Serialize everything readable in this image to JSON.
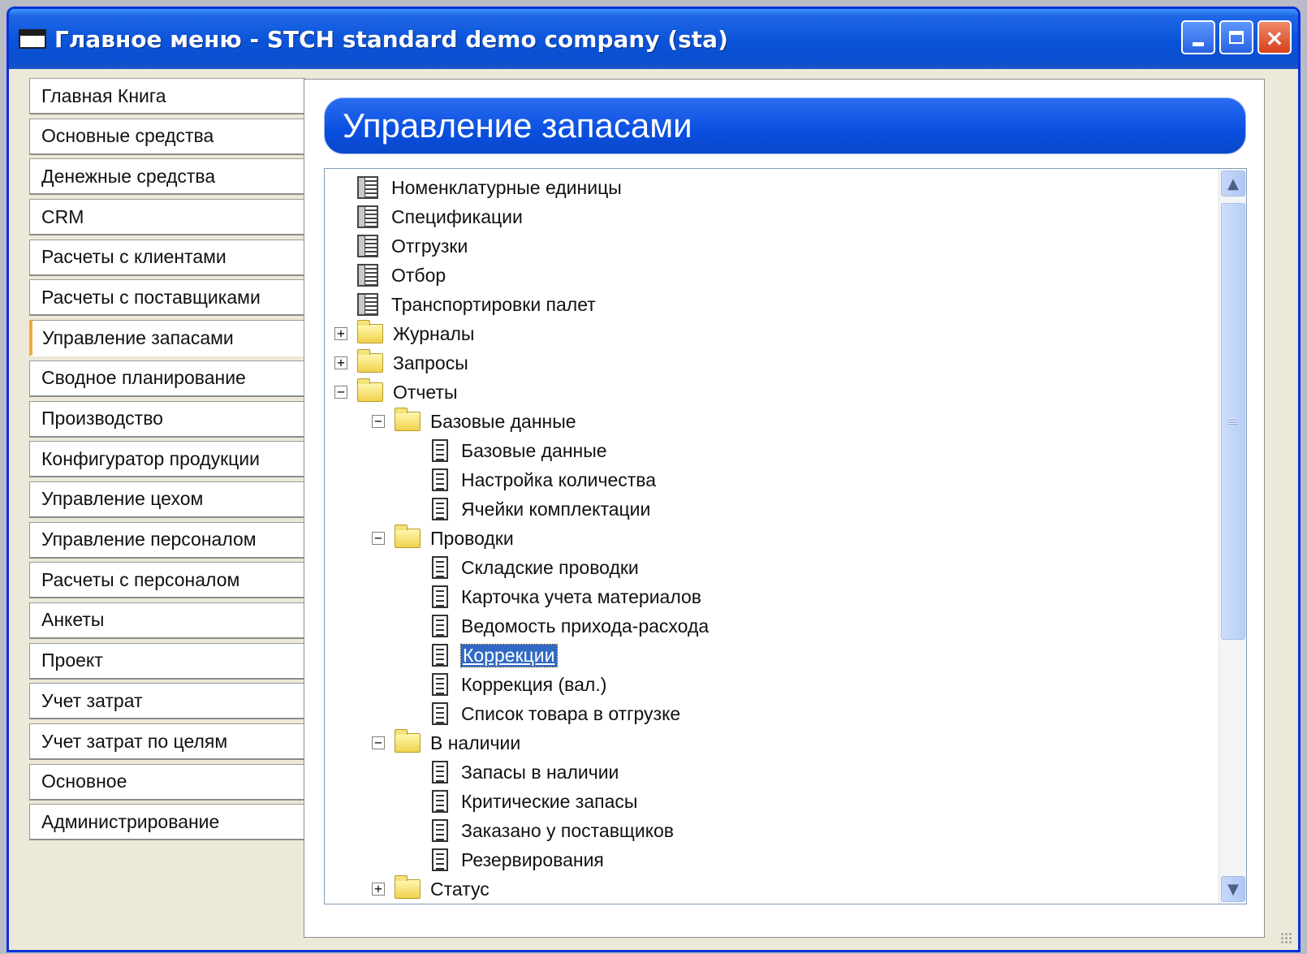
{
  "window": {
    "title": "Главное меню  -  STCH standard demo company (sta)",
    "buttons": {
      "minimize": "minimize",
      "maximize": "maximize",
      "close": "×"
    }
  },
  "nav": {
    "items": [
      {
        "label": "Главная Книга"
      },
      {
        "label": "Основные средства"
      },
      {
        "label": "Денежные средства"
      },
      {
        "label": "CRM"
      },
      {
        "label": "Расчеты с клиентами"
      },
      {
        "label": "Расчеты с поставщиками"
      },
      {
        "label": "Управление запасами",
        "active": true
      },
      {
        "label": "Сводное планирование"
      },
      {
        "label": "Производство"
      },
      {
        "label": "Конфигуратор продукции"
      },
      {
        "label": "Управление цехом"
      },
      {
        "label": "Управление персоналом"
      },
      {
        "label": "Расчеты с персоналом"
      },
      {
        "label": "Анкеты"
      },
      {
        "label": "Проект"
      },
      {
        "label": "Учет затрат"
      },
      {
        "label": "Учет затрат по целям"
      },
      {
        "label": "Основное"
      },
      {
        "label": "Администрирование"
      }
    ]
  },
  "section": {
    "title": "Управление запасами"
  },
  "tree": {
    "nodes": [
      {
        "label": "Номенклатурные единицы",
        "depth": 0,
        "type": "list",
        "expander": null
      },
      {
        "label": "Спецификации",
        "depth": 0,
        "type": "list",
        "expander": null
      },
      {
        "label": "Отгрузки",
        "depth": 0,
        "type": "list",
        "expander": null
      },
      {
        "label": "Отбор",
        "depth": 0,
        "type": "list",
        "expander": null
      },
      {
        "label": "Транспортировки палет",
        "depth": 0,
        "type": "list",
        "expander": null
      },
      {
        "label": "Журналы",
        "depth": 0,
        "type": "folder",
        "expander": "+"
      },
      {
        "label": "Запросы",
        "depth": 0,
        "type": "folder",
        "expander": "+"
      },
      {
        "label": "Отчеты",
        "depth": 0,
        "type": "folder",
        "expander": "−"
      },
      {
        "label": "Базовые данные",
        "depth": 1,
        "type": "folder",
        "expander": "−"
      },
      {
        "label": "Базовые данные",
        "depth": 2,
        "type": "report",
        "expander": null
      },
      {
        "label": "Настройка количества",
        "depth": 2,
        "type": "report",
        "expander": null
      },
      {
        "label": "Ячейки комплектации",
        "depth": 2,
        "type": "report",
        "expander": null
      },
      {
        "label": "Проводки",
        "depth": 1,
        "type": "folder",
        "expander": "−"
      },
      {
        "label": "Складские проводки",
        "depth": 2,
        "type": "report",
        "expander": null
      },
      {
        "label": "Карточка учета материалов",
        "depth": 2,
        "type": "report",
        "expander": null
      },
      {
        "label": "Ведомость прихода-расхода",
        "depth": 2,
        "type": "report",
        "expander": null
      },
      {
        "label": "Коррекции",
        "depth": 2,
        "type": "report",
        "expander": null,
        "selected": true
      },
      {
        "label": "Коррекция (вал.)",
        "depth": 2,
        "type": "report",
        "expander": null
      },
      {
        "label": "Список товара в отгрузке",
        "depth": 2,
        "type": "report",
        "expander": null
      },
      {
        "label": "В наличии",
        "depth": 1,
        "type": "folder",
        "expander": "−"
      },
      {
        "label": "Запасы в наличии",
        "depth": 2,
        "type": "report",
        "expander": null
      },
      {
        "label": "Критические запасы",
        "depth": 2,
        "type": "report",
        "expander": null
      },
      {
        "label": "Заказано у поставщиков",
        "depth": 2,
        "type": "report",
        "expander": null
      },
      {
        "label": "Резервирования",
        "depth": 2,
        "type": "report",
        "expander": null
      },
      {
        "label": "Статус",
        "depth": 1,
        "type": "folder",
        "expander": "+"
      }
    ]
  },
  "scrollbar": {
    "up": "▲",
    "down": "▼"
  },
  "colors": {
    "titlebar": "#0a53d8",
    "header": "#0a4fe0",
    "selection": "#316ac5",
    "active_tab_accent": "#f4a73a"
  }
}
